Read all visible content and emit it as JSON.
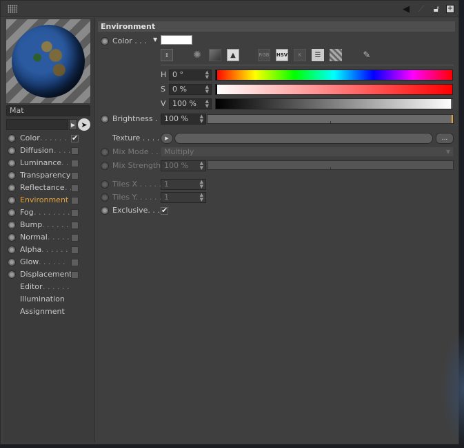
{
  "titlebar": {
    "icons": [
      "pointer-arrow-icon",
      "pin-icon",
      "lock-icon",
      "add-window-icon"
    ]
  },
  "left_panel": {
    "material_name": "Mat",
    "channels": [
      {
        "label": "Color",
        "dots": " . . . . . .",
        "checked": true,
        "active": false,
        "has_toggle": true
      },
      {
        "label": "Diffusion",
        "dots": " . . . .",
        "checked": false,
        "active": false,
        "has_toggle": true
      },
      {
        "label": "Luminance",
        "dots": " . .",
        "checked": false,
        "active": false,
        "has_toggle": true
      },
      {
        "label": "Transparency",
        "dots": "",
        "checked": false,
        "active": false,
        "has_toggle": true
      },
      {
        "label": "Reflectance",
        "dots": " . .",
        "checked": false,
        "active": false,
        "has_toggle": true
      },
      {
        "label": "Environment",
        "dots": "",
        "checked": false,
        "active": true,
        "has_toggle": true
      },
      {
        "label": "Fog",
        "dots": " . . . . . . . .",
        "checked": false,
        "active": false,
        "has_toggle": true
      },
      {
        "label": "Bump",
        "dots": " . . . . . .",
        "checked": false,
        "active": false,
        "has_toggle": true
      },
      {
        "label": "Normal",
        "dots": " . . . . .",
        "checked": false,
        "active": false,
        "has_toggle": true
      },
      {
        "label": "Alpha",
        "dots": " . . . . . .",
        "checked": false,
        "active": false,
        "has_toggle": true
      },
      {
        "label": "Glow",
        "dots": " . . . . . .",
        "checked": false,
        "active": false,
        "has_toggle": true
      },
      {
        "label": "Displacement",
        "dots": "",
        "checked": false,
        "active": false,
        "has_toggle": true
      },
      {
        "label": "Editor",
        "dots": " . . . . . .",
        "checked": false,
        "active": false,
        "has_toggle": false
      },
      {
        "label": "Illumination",
        "dots": "",
        "checked": false,
        "active": false,
        "has_toggle": false
      },
      {
        "label": "Assignment",
        "dots": "",
        "checked": false,
        "active": false,
        "has_toggle": false
      }
    ]
  },
  "environment": {
    "header": "Environment",
    "color_label": "Color . . .",
    "color_swatch": "#ffffff",
    "mode_buttons": {
      "rgb": "RGB",
      "hsv": "HSV",
      "k": "K"
    },
    "h": {
      "label": "H",
      "value": "0 °"
    },
    "s": {
      "label": "S",
      "value": "0 %"
    },
    "v": {
      "label": "V",
      "value": "100 %"
    },
    "brightness": {
      "label": "Brightness . .",
      "value": "100 %",
      "level": 1.0
    },
    "texture_label": "Texture . . . . .",
    "texture_more": "...",
    "mix_mode": {
      "label": "Mix Mode . .",
      "value": "Multiply"
    },
    "mix_strength": {
      "label": "Mix Strength",
      "value": "100 %",
      "level": 1.0
    },
    "tiles_x": {
      "label": "Tiles X . . . . .",
      "value": "1"
    },
    "tiles_y": {
      "label": "Tiles Y. . . . . .",
      "value": "1"
    },
    "exclusive": {
      "label": "Exclusive. . . .",
      "checked": true
    }
  }
}
